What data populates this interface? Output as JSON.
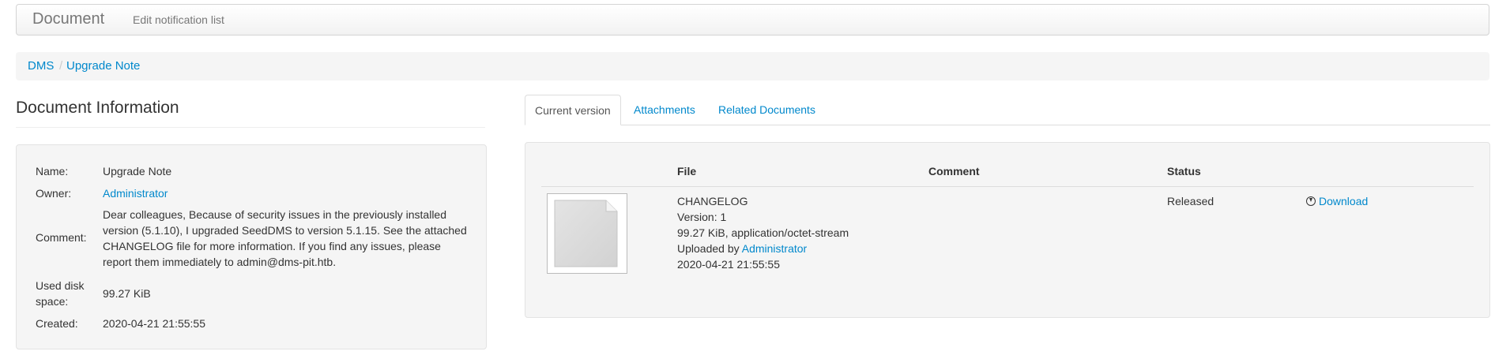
{
  "navbar": {
    "brand": "Document",
    "link": "Edit notification list"
  },
  "breadcrumb": {
    "items": [
      "DMS",
      "Upgrade Note"
    ],
    "separator": "/"
  },
  "info": {
    "title": "Document Information",
    "name_label": "Name:",
    "name_value": "Upgrade Note",
    "owner_label": "Owner:",
    "owner_value": "Administrator",
    "comment_label": "Comment:",
    "comment_value": "Dear colleagues, Because of security issues in the previously installed version (5.1.10), I upgraded SeedDMS to version 5.1.15. See the attached CHANGELOG file for more information. If you find any issues, please report them immediately to admin@dms-pit.htb.",
    "disk_label_1": "Used disk",
    "disk_label_2": "space:",
    "disk_value": "99.27 KiB",
    "created_label": "Created:",
    "created_value": "2020-04-21 21:55:55"
  },
  "tabs": [
    "Current version",
    "Attachments",
    "Related Documents"
  ],
  "version": {
    "headers": {
      "file": "File",
      "comment": "Comment",
      "status": "Status"
    },
    "file_name": "CHANGELOG",
    "version_line": "Version: 1",
    "size_line": "99.27 KiB, application/octet-stream",
    "uploaded_prefix": "Uploaded by",
    "uploaded_by": "Administrator",
    "date": "2020-04-21 21:55:55",
    "status": "Released",
    "download_label": "Download"
  },
  "icons": {
    "thumbnail": "document-thumbnail-icon",
    "download": "download-icon"
  },
  "colors": {
    "link": "#0088cc",
    "well": "#f5f5f5"
  }
}
